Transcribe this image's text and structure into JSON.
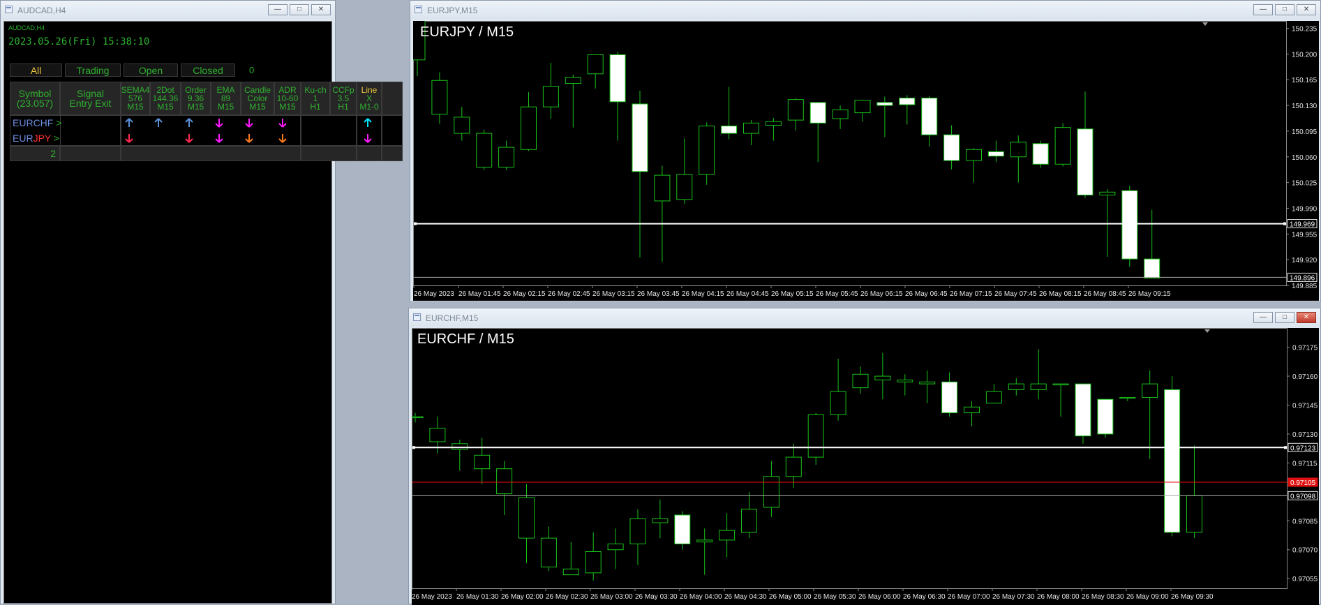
{
  "panel": {
    "window_title": "AUDCAD,H4",
    "header_label": "AUDCAD,H4",
    "datetime": "2023.05.26(Fri) 15:38:10",
    "tabs": [
      {
        "label": "All",
        "color": "#e8c23a"
      },
      {
        "label": "Trading",
        "color": "#2fb12f"
      },
      {
        "label": "Open",
        "color": "#2fb12f"
      },
      {
        "label": "Closed",
        "color": "#2fb12f"
      }
    ],
    "tab_count": "0",
    "table_headers": [
      {
        "lines": [
          "Symbol",
          "(23.057)"
        ]
      },
      {
        "lines": [
          "Signal",
          "Entry Exit"
        ]
      },
      {
        "lines": [
          "SEMA4",
          "576",
          "M15"
        ]
      },
      {
        "lines": [
          "2Dot",
          "144.36",
          "M15"
        ]
      },
      {
        "lines": [
          "Order",
          "9.36",
          "M15"
        ]
      },
      {
        "lines": [
          "EMA",
          "89",
          "M15"
        ]
      },
      {
        "lines": [
          "Candle",
          "Color",
          "M15"
        ]
      },
      {
        "lines": [
          "ADR",
          "10-60",
          "M15"
        ]
      },
      {
        "lines": [
          "Ku-ch",
          "1",
          "H1"
        ]
      },
      {
        "lines": [
          "CCFp",
          "3.5",
          "H1"
        ]
      },
      {
        "lines": [
          "Line",
          "X",
          "M1-0"
        ]
      }
    ],
    "rows": [
      {
        "symbol_a": "EUR",
        "symbol_b": "CHF",
        "symbol_b_color": "#6d8ce0",
        "arrow": ">",
        "signals": [
          {
            "dir": "up",
            "color": "#5b8fd6"
          },
          {
            "dir": "up",
            "color": "#5b8fd6"
          },
          {
            "dir": "up",
            "color": "#5b8fd6"
          },
          {
            "dir": "down",
            "color": "#ff1aff"
          },
          {
            "dir": "down",
            "color": "#ff1aff"
          },
          {
            "dir": "down",
            "color": "#ff1aff"
          }
        ],
        "line_signal": {
          "dir": "up",
          "color": "#00e5ff"
        }
      },
      {
        "symbol_a": "EUR",
        "symbol_b": "JPY",
        "symbol_b_color": "#ff3030",
        "arrow": ">",
        "signals": [
          {
            "dir": "down",
            "color": "#ff2a50"
          },
          null,
          {
            "dir": "down",
            "color": "#ff2a50"
          },
          {
            "dir": "down",
            "color": "#ff1aff"
          },
          {
            "dir": "down",
            "color": "#ff7a1a"
          },
          {
            "dir": "down",
            "color": "#ff7a1a"
          }
        ],
        "line_signal": {
          "dir": "down",
          "color": "#ff1aff"
        }
      }
    ],
    "footer_count": "2"
  },
  "chart_data": [
    {
      "type": "candlestick",
      "window_title": "EURJPY,M15",
      "title": "EURJPY / M15",
      "ylim": [
        149.885,
        150.245
      ],
      "y_ticks": [
        "150.235",
        "150.200",
        "150.165",
        "150.130",
        "150.095",
        "150.060",
        "150.025",
        "149.990",
        "149.955",
        "149.920",
        "149.885"
      ],
      "x_labels": [
        "26 May 2023",
        "26 May 01:45",
        "26 May 02:15",
        "26 May 02:45",
        "26 May 03:15",
        "26 May 03:45",
        "26 May 04:15",
        "26 May 04:45",
        "26 May 05:15",
        "26 May 05:45",
        "26 May 06:15",
        "26 May 06:45",
        "26 May 07:15",
        "26 May 07:45",
        "26 May 08:15",
        "26 May 08:45",
        "26 May 09:15"
      ],
      "hlines": [
        {
          "value": 149.969,
          "label": "149.969",
          "color": "#ffffff",
          "width": 2
        },
        {
          "value": 149.896,
          "label": "149.896",
          "color": "#aaaaaa",
          "width": 1
        }
      ],
      "candles": [
        {
          "o": 150.192,
          "h": 150.25,
          "l": 150.17,
          "c": 150.248
        },
        {
          "o": 150.118,
          "h": 150.175,
          "l": 150.105,
          "c": 150.164
        },
        {
          "o": 150.092,
          "h": 150.128,
          "l": 150.082,
          "c": 150.114
        },
        {
          "o": 150.046,
          "h": 150.097,
          "l": 150.042,
          "c": 150.092
        },
        {
          "o": 150.046,
          "h": 150.082,
          "l": 150.042,
          "c": 150.073
        },
        {
          "o": 150.07,
          "h": 150.148,
          "l": 150.068,
          "c": 150.128
        },
        {
          "o": 150.128,
          "h": 150.188,
          "l": 150.112,
          "c": 150.156
        },
        {
          "o": 150.16,
          "h": 150.172,
          "l": 150.1,
          "c": 150.168
        },
        {
          "o": 150.173,
          "h": 150.196,
          "l": 150.153,
          "c": 150.199
        },
        {
          "o": 150.199,
          "h": 150.203,
          "l": 150.082,
          "c": 150.135
        },
        {
          "o": 150.132,
          "h": 150.15,
          "l": 149.923,
          "c": 150.04
        },
        {
          "o": 150.0,
          "h": 150.048,
          "l": 149.917,
          "c": 150.035
        },
        {
          "o": 150.002,
          "h": 150.085,
          "l": 149.996,
          "c": 150.036
        },
        {
          "o": 150.036,
          "h": 150.107,
          "l": 150.022,
          "c": 150.102
        },
        {
          "o": 150.102,
          "h": 150.155,
          "l": 150.084,
          "c": 150.092
        },
        {
          "o": 150.092,
          "h": 150.11,
          "l": 150.076,
          "c": 150.106
        },
        {
          "o": 150.103,
          "h": 150.113,
          "l": 150.082,
          "c": 150.108
        },
        {
          "o": 150.11,
          "h": 150.14,
          "l": 150.096,
          "c": 150.138
        },
        {
          "o": 150.134,
          "h": 150.134,
          "l": 150.053,
          "c": 150.106
        },
        {
          "o": 150.112,
          "h": 150.13,
          "l": 150.098,
          "c": 150.124
        },
        {
          "o": 150.12,
          "h": 150.138,
          "l": 150.108,
          "c": 150.137
        },
        {
          "o": 150.134,
          "h": 150.142,
          "l": 150.087,
          "c": 150.13
        },
        {
          "o": 150.14,
          "h": 150.144,
          "l": 150.104,
          "c": 150.131
        },
        {
          "o": 150.14,
          "h": 150.143,
          "l": 150.074,
          "c": 150.09
        },
        {
          "o": 150.09,
          "h": 150.103,
          "l": 150.043,
          "c": 150.055
        },
        {
          "o": 150.055,
          "h": 150.072,
          "l": 150.025,
          "c": 150.07
        },
        {
          "o": 150.067,
          "h": 150.082,
          "l": 150.053,
          "c": 150.061
        },
        {
          "o": 150.06,
          "h": 150.089,
          "l": 150.025,
          "c": 150.08
        },
        {
          "o": 150.078,
          "h": 150.082,
          "l": 150.045,
          "c": 150.05
        },
        {
          "o": 150.05,
          "h": 150.106,
          "l": 150.047,
          "c": 150.1
        },
        {
          "o": 150.098,
          "h": 150.149,
          "l": 150.004,
          "c": 150.008
        },
        {
          "o": 150.008,
          "h": 150.016,
          "l": 149.924,
          "c": 150.012
        },
        {
          "o": 150.014,
          "h": 150.021,
          "l": 149.91,
          "c": 149.921
        },
        {
          "o": 149.921,
          "h": 149.988,
          "l": 149.895,
          "c": 149.895
        }
      ]
    },
    {
      "type": "candlestick",
      "window_title": "EURCHF,M15",
      "title": "EURCHF / M15",
      "ylim": [
        0.9705,
        0.97185
      ],
      "y_ticks": [
        "0.97175",
        "0.97160",
        "0.97145",
        "0.97130",
        "0.97115",
        "0.97100",
        "0.97085",
        "0.97070",
        "0.97055"
      ],
      "x_labels": [
        "26 May 2023",
        "26 May 01:30",
        "26 May 02:00",
        "26 May 02:30",
        "26 May 03:00",
        "26 May 03:30",
        "26 May 04:00",
        "26 May 04:30",
        "26 May 05:00",
        "26 May 05:30",
        "26 May 06:00",
        "26 May 06:30",
        "26 May 07:00",
        "26 May 07:30",
        "26 May 08:00",
        "26 May 08:30",
        "26 May 09:00",
        "26 May 09:30"
      ],
      "hlines": [
        {
          "value": 0.97123,
          "label": "0.97123",
          "color": "#ffffff",
          "width": 2
        },
        {
          "value": 0.97105,
          "label": "0.97105",
          "color": "#e01010",
          "width": 1,
          "label_bg": "#e01010"
        },
        {
          "value": 0.97098,
          "label": "0.97098",
          "color": "#aaaaaa",
          "width": 1
        }
      ],
      "hidden_tick_label": "0.97100",
      "candles": [
        {
          "o": 0.97139,
          "h": 0.97141,
          "l": 0.97136,
          "c": 0.97139
        },
        {
          "o": 0.97126,
          "h": 0.97139,
          "l": 0.9712,
          "c": 0.97133
        },
        {
          "o": 0.97122,
          "h": 0.97127,
          "l": 0.97111,
          "c": 0.97125
        },
        {
          "o": 0.97112,
          "h": 0.97128,
          "l": 0.97104,
          "c": 0.97119
        },
        {
          "o": 0.97099,
          "h": 0.97116,
          "l": 0.97088,
          "c": 0.97112
        },
        {
          "o": 0.97076,
          "h": 0.97104,
          "l": 0.97063,
          "c": 0.97097
        },
        {
          "o": 0.97061,
          "h": 0.97082,
          "l": 0.97059,
          "c": 0.97076
        },
        {
          "o": 0.97057,
          "h": 0.97074,
          "l": 0.97057,
          "c": 0.9706
        },
        {
          "o": 0.97058,
          "h": 0.97079,
          "l": 0.97054,
          "c": 0.97069
        },
        {
          "o": 0.9707,
          "h": 0.97081,
          "l": 0.9706,
          "c": 0.97073
        },
        {
          "o": 0.97073,
          "h": 0.97091,
          "l": 0.97062,
          "c": 0.97086
        },
        {
          "o": 0.97084,
          "h": 0.97096,
          "l": 0.97076,
          "c": 0.97086
        },
        {
          "o": 0.97088,
          "h": 0.9709,
          "l": 0.9707,
          "c": 0.97073
        },
        {
          "o": 0.97074,
          "h": 0.97081,
          "l": 0.97057,
          "c": 0.97075
        },
        {
          "o": 0.97075,
          "h": 0.97089,
          "l": 0.97066,
          "c": 0.9708
        },
        {
          "o": 0.97079,
          "h": 0.971,
          "l": 0.97076,
          "c": 0.97091
        },
        {
          "o": 0.97092,
          "h": 0.97116,
          "l": 0.97087,
          "c": 0.97108
        },
        {
          "o": 0.97108,
          "h": 0.97125,
          "l": 0.97102,
          "c": 0.97118
        },
        {
          "o": 0.97118,
          "h": 0.97141,
          "l": 0.97114,
          "c": 0.9714
        },
        {
          "o": 0.9714,
          "h": 0.97169,
          "l": 0.97137,
          "c": 0.97152
        },
        {
          "o": 0.97154,
          "h": 0.97165,
          "l": 0.97151,
          "c": 0.97161
        },
        {
          "o": 0.97158,
          "h": 0.97172,
          "l": 0.97148,
          "c": 0.9716
        },
        {
          "o": 0.97157,
          "h": 0.97161,
          "l": 0.9715,
          "c": 0.97158
        },
        {
          "o": 0.97156,
          "h": 0.97163,
          "l": 0.97146,
          "c": 0.97157
        },
        {
          "o": 0.97157,
          "h": 0.97162,
          "l": 0.97139,
          "c": 0.97141
        },
        {
          "o": 0.97141,
          "h": 0.97147,
          "l": 0.97134,
          "c": 0.97144
        },
        {
          "o": 0.97146,
          "h": 0.97156,
          "l": 0.97146,
          "c": 0.97152
        },
        {
          "o": 0.97153,
          "h": 0.97159,
          "l": 0.9715,
          "c": 0.97156
        },
        {
          "o": 0.97153,
          "h": 0.97174,
          "l": 0.97148,
          "c": 0.97156
        },
        {
          "o": 0.97156,
          "h": 0.97156,
          "l": 0.97139,
          "c": 0.97156
        },
        {
          "o": 0.97156,
          "h": 0.97156,
          "l": 0.97125,
          "c": 0.97129
        },
        {
          "o": 0.97148,
          "h": 0.97148,
          "l": 0.97128,
          "c": 0.9713
        },
        {
          "o": 0.97149,
          "h": 0.97149,
          "l": 0.97147,
          "c": 0.97149
        },
        {
          "o": 0.97149,
          "h": 0.97163,
          "l": 0.97117,
          "c": 0.97156
        },
        {
          "o": 0.97153,
          "h": 0.9716,
          "l": 0.97077,
          "c": 0.97079
        },
        {
          "o": 0.97079,
          "h": 0.97124,
          "l": 0.97076,
          "c": 0.97098
        }
      ]
    }
  ]
}
